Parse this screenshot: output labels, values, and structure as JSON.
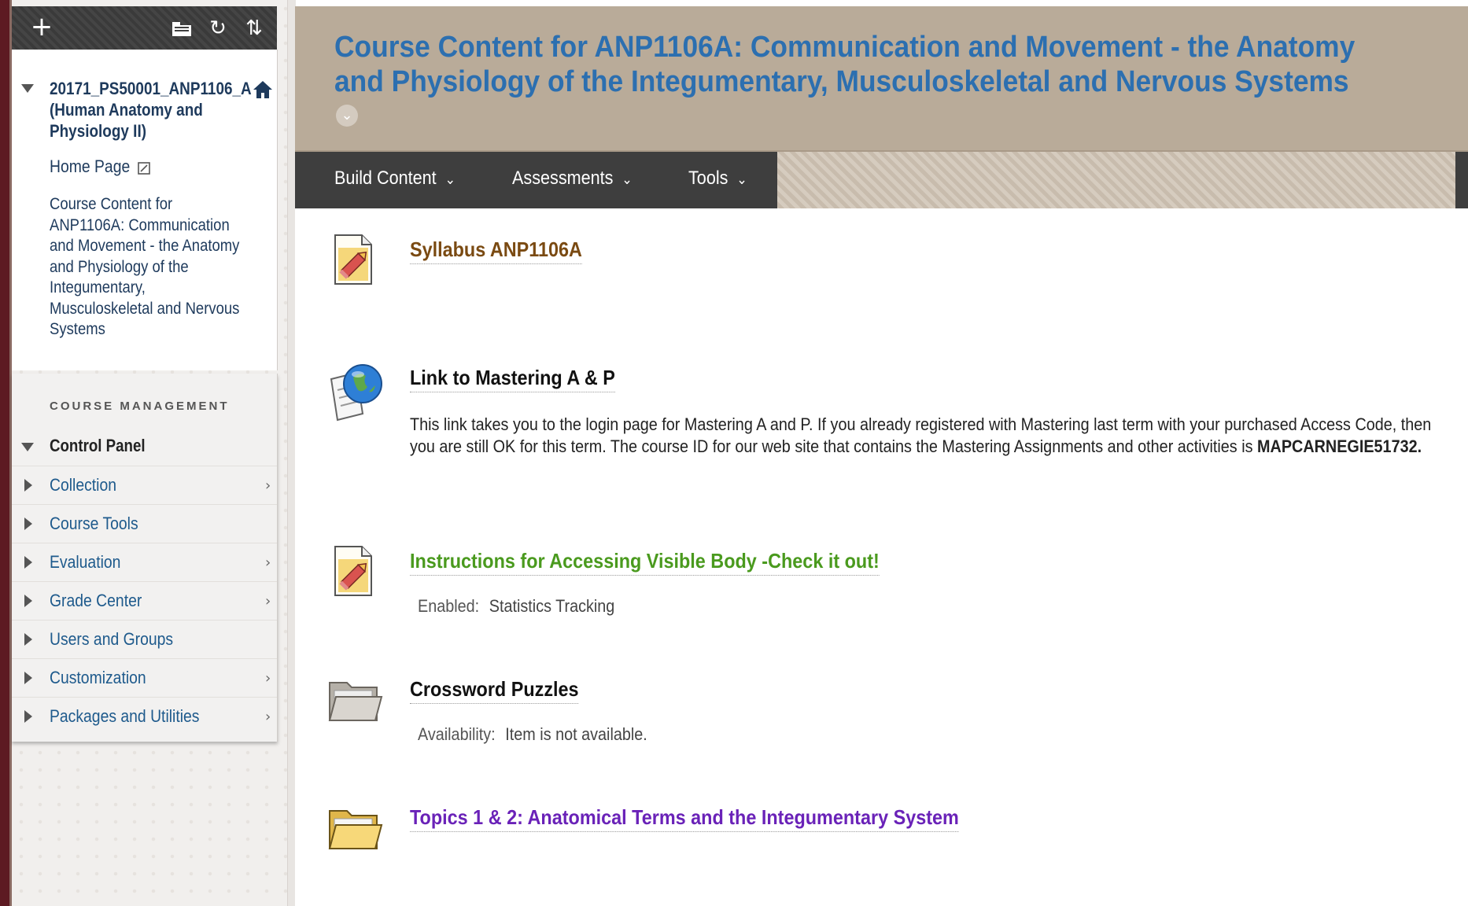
{
  "sidebar": {
    "toolbar": {
      "add_glyph": "+",
      "folder_glyph": "🗀",
      "refresh_glyph": "↻",
      "sort_glyph": "⇅"
    },
    "course_title": "20171_PS50001_ANP1106_A (Human Anatomy and Physiology II)",
    "home_page": "Home Page",
    "course_content": "Course Content for ANP1106A: Communication and Movement - the Anatomy and Physiology of the Integumentary, Musculoskeletal and Nervous Systems",
    "management": {
      "heading": "COURSE MANAGEMENT",
      "control_panel": "Control Panel",
      "items": [
        {
          "label": "Collection",
          "chevron": "›"
        },
        {
          "label": "Course Tools",
          "chevron": ""
        },
        {
          "label": "Evaluation",
          "chevron": "›"
        },
        {
          "label": "Grade Center",
          "chevron": "›"
        },
        {
          "label": "Users and Groups",
          "chevron": ""
        },
        {
          "label": "Customization",
          "chevron": "›"
        },
        {
          "label": "Packages and Utilities",
          "chevron": "›"
        }
      ]
    }
  },
  "header": {
    "title": "Course Content for ANP1106A: Communication and Movement - the Anatomy and Physiology of the Integumentary, Musculoskeletal and Nervous Systems",
    "options_glyph": "⌄"
  },
  "action_bar": {
    "build_content": "Build Content",
    "assessments": "Assessments",
    "tools": "Tools",
    "caret": "⌄"
  },
  "content": [
    {
      "title": "Syllabus ANP1106A",
      "icon": "document-icon",
      "color": "#7a4a12"
    },
    {
      "title": "Link to Mastering A & P",
      "icon": "web-link-icon",
      "color": "#111111",
      "desc_text": "This link takes you to the login page for Mastering A and P.  If you already registered with Mastering last term with your purchased Access Code, then you are still OK for this term.  The course ID for our web site that contains the Mastering Assignments and other activities is",
      "desc_bold": "MAPCARNEGIE51732."
    },
    {
      "title": "Instructions for Accessing Visible Body -Check it out!",
      "icon": "document-icon",
      "color": "#4a9a1e",
      "meta_label": "Enabled:",
      "meta_value": "Statistics Tracking"
    },
    {
      "title": "Crossword Puzzles",
      "icon": "folder-grey-icon",
      "color": "#111111",
      "meta_label": "Availability:",
      "meta_value": "Item is not available."
    },
    {
      "title": "Topics 1 & 2: Anatomical Terms and the Integumentary System",
      "icon": "folder-icon",
      "color": "#6a22b8"
    }
  ]
}
